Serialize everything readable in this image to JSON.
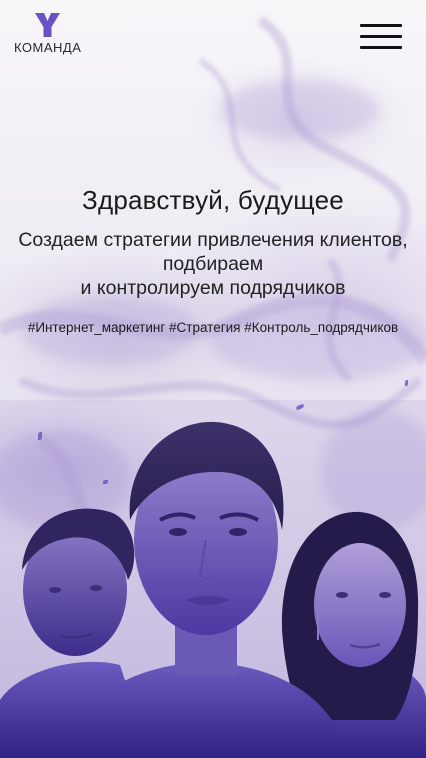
{
  "header": {
    "logo_letter": "Y",
    "logo_text": "КОМАНДА",
    "menu_icon": "hamburger-icon"
  },
  "hero": {
    "title": "Здравствуй, будущее",
    "subtitle_line1": "Создаем стратегии привлечения клиентов,",
    "subtitle_line2": "подбираем",
    "subtitle_line3": "и контролируем подрядчиков",
    "tags": "#Интернет_маркетинг #Стратегия #Контроль_подрядчиков"
  },
  "colors": {
    "brand": "#6a52c4",
    "text": "#1b1b1b",
    "tint": "#7b66c8"
  }
}
